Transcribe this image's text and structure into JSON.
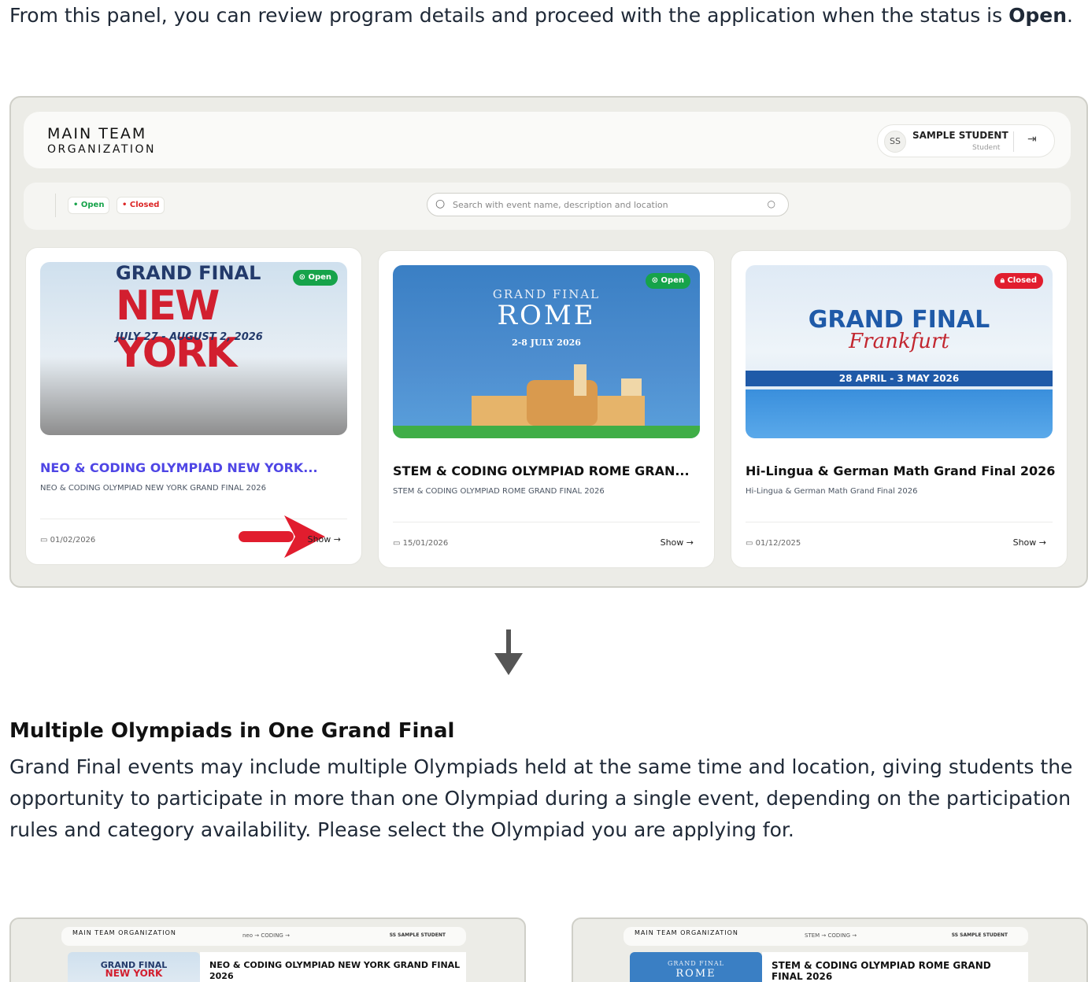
{
  "intro": {
    "text": "From this panel, you can review program details and proceed with the application when the status is",
    "bold": "Open",
    "end": "."
  },
  "app": {
    "brand_line1": "MAIN TEAM",
    "brand_line2": "ORGANIZATION",
    "user_initials": "SS",
    "user_name": "SAMPLE STUDENT",
    "user_role": "Student"
  },
  "filters": {
    "open_label": "• Open",
    "closed_label": "• Closed",
    "search_placeholder": "Search with event name, description and location"
  },
  "cards": [
    {
      "status": "Open",
      "title": "NEO & CODING OLYMPIAD NEW YORK...",
      "subtitle": "NEO & CODING OLYMPIAD NEW YORK GRAND FINAL 2026",
      "date": "01/02/2026",
      "show": "Show",
      "art_line1": "GRAND FINAL",
      "art_line2": "NEW YORK",
      "art_line3": "JULY 27 - AUGUST 2, 2026"
    },
    {
      "status": "Open",
      "title": "STEM & CODING OLYMPIAD ROME GRAN...",
      "subtitle": "STEM & CODING OLYMPIAD ROME GRAND FINAL 2026",
      "date": "15/01/2026",
      "show": "Show",
      "art_line1": "GRAND FINAL",
      "art_line2": "ROME",
      "art_line3": "2-8 JULY 2026"
    },
    {
      "status": "Closed",
      "title": "Hi-Lingua & German Math Grand Final 2026",
      "subtitle": "Hi-Lingua & German Math Grand Final 2026",
      "date": "01/12/2025",
      "show": "Show",
      "art_line1": "GRAND FINAL",
      "art_line2": "Frankfurt",
      "art_line3": "28 APRIL - 3 MAY 2026"
    }
  ],
  "section": {
    "title": "Multiple Olympiads in One Grand Final",
    "body": "Grand Final events may include multiple Olympiads held at the same time and location, giving students the opportunity to participate in more than one Olympiad during a single event, depending on the participation rules and category availability. Please select the Olympiad you are applying for."
  },
  "previews": [
    {
      "brand": "MAIN TEAM ORGANIZATION",
      "logo_small": "NEW YORK",
      "nav": "neo → CODING →",
      "user": "SS  SAMPLE STUDENT",
      "thumb1": "GRAND FINAL",
      "thumb2": "NEW YORK",
      "title": "NEO & CODING OLYMPIAD NEW YORK GRAND FINAL 2026"
    },
    {
      "brand": "MAIN TEAM ORGANIZATION",
      "logo_small": "ROME",
      "nav": "STEM → CODING →",
      "user": "SS  SAMPLE STUDENT",
      "thumb1": "GRAND FINAL",
      "thumb2": "ROME",
      "title": "STEM & CODING OLYMPIAD ROME GRAND FINAL 2026"
    }
  ],
  "colors": {
    "open": "#16a34a",
    "closed": "#e11d2e",
    "highlight_title": "#4f46e5",
    "pointer_arrow": "#e11d2e"
  }
}
